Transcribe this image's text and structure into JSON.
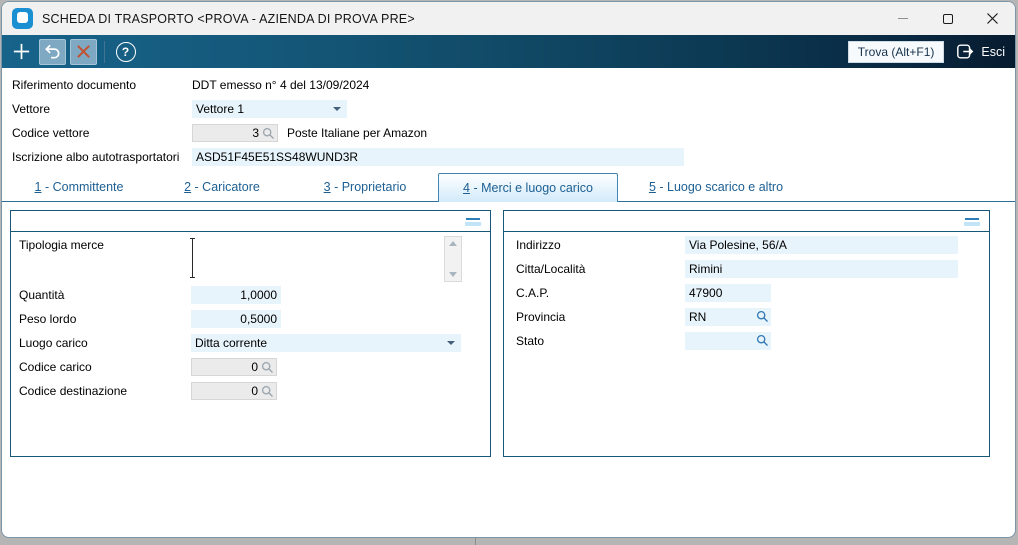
{
  "window": {
    "title": "SCHEDA DI TRASPORTO <PROVA - AZIENDA DI PROVA PRE>"
  },
  "toolbar": {
    "trova_label": "Trova (Alt+F1)",
    "esci_label": "Esci",
    "help_glyph": "?"
  },
  "header_form": {
    "riferimento_label": "Riferimento documento",
    "riferimento_value": "DDT emesso n° 4 del 13/09/2024",
    "vettore_label": "Vettore",
    "vettore_value": "Vettore 1",
    "codice_vettore_label": "Codice vettore",
    "codice_vettore_value": "3",
    "codice_vettore_desc": "Poste Italiane per Amazon",
    "iscrizione_label": "Iscrizione albo autotrasportatori",
    "iscrizione_value": "ASD51F45E51SS48WUND3R"
  },
  "tabs": [
    {
      "accel": "1",
      "rest": " - Committente"
    },
    {
      "accel": "2",
      "rest": " - Caricatore"
    },
    {
      "accel": "3",
      "rest": " - Proprietario"
    },
    {
      "accel": "4",
      "rest": " - Merci e luogo carico"
    },
    {
      "accel": "5",
      "rest": " - Luogo scarico e altro"
    }
  ],
  "left_panel": {
    "tipologia_label": "Tipologia merce",
    "tipologia_value": "",
    "quantita_label": "Quantità",
    "quantita_value": "1,0000",
    "peso_label": "Peso lordo",
    "peso_value": "0,5000",
    "luogo_label": "Luogo carico",
    "luogo_value": "Ditta corrente",
    "codice_carico_label": "Codice carico",
    "codice_carico_value": "0",
    "codice_dest_label": "Codice destinazione",
    "codice_dest_value": "0"
  },
  "right_panel": {
    "indirizzo_label": "Indirizzo",
    "indirizzo_value": "Via Polesine, 56/A",
    "citta_label": "Citta/Località",
    "citta_value": "Rimini",
    "cap_label": "C.A.P.",
    "cap_value": "47900",
    "provincia_label": "Provincia",
    "provincia_value": "RN",
    "stato_label": "Stato",
    "stato_value": ""
  },
  "colors": {
    "toolbar_gradient_start": "#17638a",
    "toolbar_gradient_end": "#071b2e",
    "field_blue": "#e8f4fb",
    "field_gray": "#ebebeb",
    "tab_text": "#1d5f93",
    "panel_border": "#175878",
    "delete_x": "#c4502e",
    "accent_blue": "#2d7fb8"
  }
}
